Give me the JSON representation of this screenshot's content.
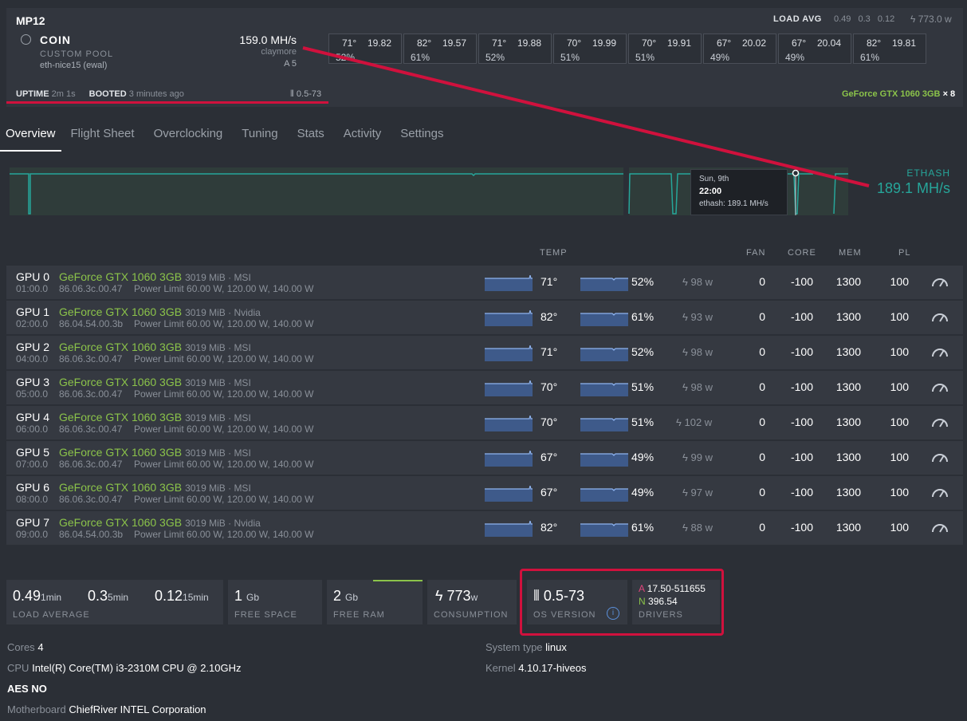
{
  "rig": {
    "name": "MP12",
    "coin": "COIN",
    "pool": "CUSTOM POOL",
    "wallet": "eth-nice15 (ewal)",
    "hashrate": "159.0 MH/s",
    "miner": "claymore",
    "version_short": "A 5",
    "uptime_label": "UPTIME",
    "uptime_value": "2m 1s",
    "booted_label": "BOOTED",
    "booted_value": "3 minutes ago",
    "os_version": "0.5-73",
    "load_avg_label": "LOAD AVG",
    "load_avg_values": "0.49 0.3 0.12",
    "power": "773.0 w",
    "gpu_model": "GeForce GTX 1060 3GB",
    "gpu_count": "× 8"
  },
  "gpu_summary": [
    {
      "temp": "71°",
      "hash": "19.82",
      "fan": "52%"
    },
    {
      "temp": "82°",
      "hash": "19.57",
      "fan": "61%"
    },
    {
      "temp": "71°",
      "hash": "19.88",
      "fan": "52%"
    },
    {
      "temp": "70°",
      "hash": "19.99",
      "fan": "51%"
    },
    {
      "temp": "70°",
      "hash": "19.91",
      "fan": "51%"
    },
    {
      "temp": "67°",
      "hash": "20.02",
      "fan": "49%"
    },
    {
      "temp": "67°",
      "hash": "20.04",
      "fan": "49%"
    },
    {
      "temp": "82°",
      "hash": "19.81",
      "fan": "61%"
    }
  ],
  "tabs": [
    "Overview",
    "Flight Sheet",
    "Overclocking",
    "Tuning",
    "Stats",
    "Activity",
    "Settings"
  ],
  "graph": {
    "algo": "ETHASH",
    "value": "189.1 MH/s",
    "tooltip_date": "Sun, 9th",
    "tooltip_time": "22:00",
    "tooltip_value": "ethash: 189.1 MH/s"
  },
  "columns": {
    "temp": "TEMP",
    "fan": "FAN",
    "core": "CORE",
    "mem": "MEM",
    "pl": "PL"
  },
  "gpus": [
    {
      "name": "GPU 0",
      "bus": "01:00.0",
      "model": "GeForce GTX 1060 3GB",
      "mem": "3019 MiB · MSI",
      "bios": "86.06.3c.00.47",
      "plimit": "Power Limit 60.00 W, 120.00 W, 140.00 W",
      "temp": "71°",
      "fan": "52%",
      "power": "98 w",
      "fan_set": "0",
      "core": "-100",
      "memclk": "1300",
      "pl": "100"
    },
    {
      "name": "GPU 1",
      "bus": "02:00.0",
      "model": "GeForce GTX 1060 3GB",
      "mem": "3019 MiB · Nvidia",
      "bios": "86.04.54.00.3b",
      "plimit": "Power Limit 60.00 W, 120.00 W, 140.00 W",
      "temp": "82°",
      "fan": "61%",
      "power": "93 w",
      "fan_set": "0",
      "core": "-100",
      "memclk": "1300",
      "pl": "100"
    },
    {
      "name": "GPU 2",
      "bus": "04:00.0",
      "model": "GeForce GTX 1060 3GB",
      "mem": "3019 MiB · MSI",
      "bios": "86.06.3c.00.47",
      "plimit": "Power Limit 60.00 W, 120.00 W, 140.00 W",
      "temp": "71°",
      "fan": "52%",
      "power": "98 w",
      "fan_set": "0",
      "core": "-100",
      "memclk": "1300",
      "pl": "100"
    },
    {
      "name": "GPU 3",
      "bus": "05:00.0",
      "model": "GeForce GTX 1060 3GB",
      "mem": "3019 MiB · MSI",
      "bios": "86.06.3c.00.47",
      "plimit": "Power Limit 60.00 W, 120.00 W, 140.00 W",
      "temp": "70°",
      "fan": "51%",
      "power": "98 w",
      "fan_set": "0",
      "core": "-100",
      "memclk": "1300",
      "pl": "100"
    },
    {
      "name": "GPU 4",
      "bus": "06:00.0",
      "model": "GeForce GTX 1060 3GB",
      "mem": "3019 MiB · MSI",
      "bios": "86.06.3c.00.47",
      "plimit": "Power Limit 60.00 W, 120.00 W, 140.00 W",
      "temp": "70°",
      "fan": "51%",
      "power": "102 w",
      "fan_set": "0",
      "core": "-100",
      "memclk": "1300",
      "pl": "100"
    },
    {
      "name": "GPU 5",
      "bus": "07:00.0",
      "model": "GeForce GTX 1060 3GB",
      "mem": "3019 MiB · MSI",
      "bios": "86.06.3c.00.47",
      "plimit": "Power Limit 60.00 W, 120.00 W, 140.00 W",
      "temp": "67°",
      "fan": "49%",
      "power": "99 w",
      "fan_set": "0",
      "core": "-100",
      "memclk": "1300",
      "pl": "100"
    },
    {
      "name": "GPU 6",
      "bus": "08:00.0",
      "model": "GeForce GTX 1060 3GB",
      "mem": "3019 MiB · MSI",
      "bios": "86.06.3c.00.47",
      "plimit": "Power Limit 60.00 W, 120.00 W, 140.00 W",
      "temp": "67°",
      "fan": "49%",
      "power": "97 w",
      "fan_set": "0",
      "core": "-100",
      "memclk": "1300",
      "pl": "100"
    },
    {
      "name": "GPU 7",
      "bus": "09:00.0",
      "model": "GeForce GTX 1060 3GB",
      "mem": "3019 MiB · Nvidia",
      "bios": "86.04.54.00.3b",
      "plimit": "Power Limit 60.00 W, 120.00 W, 140.00 W",
      "temp": "82°",
      "fan": "61%",
      "power": "88 w",
      "fan_set": "0",
      "core": "-100",
      "memclk": "1300",
      "pl": "100"
    }
  ],
  "stats": {
    "load1": "0.49",
    "load1_unit": "1min",
    "load5": "0.3",
    "load5_unit": "5min",
    "load15": "0.12",
    "load15_unit": "15min",
    "load_label": "LOAD AVERAGE",
    "free_space": "1",
    "free_space_unit": "Gb",
    "free_space_label": "FREE SPACE",
    "free_ram": "2",
    "free_ram_unit": "Gb",
    "free_ram_label": "FREE RAM",
    "consumption": "773",
    "consumption_unit": "w",
    "consumption_label": "CONSUMPTION",
    "os_version": "0.5-73",
    "os_label": "OS VERSION",
    "driver_a_prefix": "A",
    "driver_a": "17.50-511655",
    "driver_n_prefix": "N",
    "driver_n": "396.54",
    "drivers_label": "DRIVERS"
  },
  "system": {
    "cores_label": "Cores",
    "cores": "4",
    "cpu_label": "CPU",
    "cpu": "Intel(R) Core(TM) i3-2310M CPU @ 2.10GHz",
    "aes_label": "AES",
    "aes": "NO",
    "mb_label": "Motherboard",
    "mb": "ChiefRiver INTEL Corporation",
    "systype_label": "System type",
    "systype": "linux",
    "kernel_label": "Kernel",
    "kernel": "4.10.17-hiveos"
  },
  "colors": {
    "accent_green": "#8bc34a",
    "teal": "#26a69a",
    "annotation_red": "#d0113d",
    "background": "#2b2f36"
  }
}
